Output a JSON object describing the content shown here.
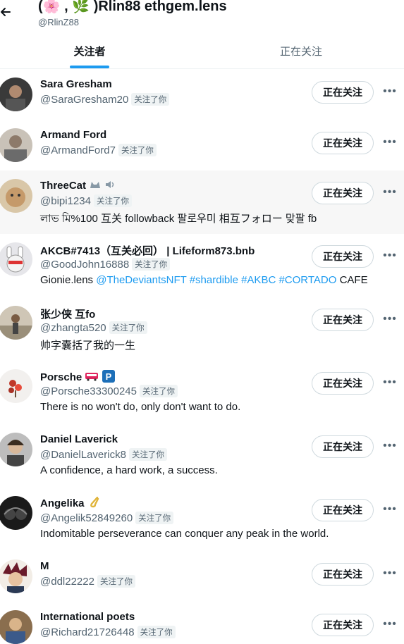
{
  "header": {
    "title": "(🌸 , 🌿 )Rlin88 ethgem.lens",
    "handle": "@RlinZ88"
  },
  "tabs": [
    {
      "label": "关注者"
    },
    {
      "label": "正在关注"
    }
  ],
  "follow_label": "正在关注",
  "follows_you_label": "关注了你",
  "users": [
    {
      "name": "Sara Gresham",
      "handle": "@SaraGresham20",
      "bio": ""
    },
    {
      "name": "Armand Ford",
      "handle": "@ArmandFord7",
      "bio": ""
    },
    {
      "name": "ThreeCat",
      "handle": "@bipi1234",
      "bio": "লাভ মি%100 互关 followback 팔로우미 相互フォロー 맞팔 fb"
    },
    {
      "name": "AKCB#7413（互关必回） | Lifeform873.bnb",
      "handle": "@GoodJohn16888",
      "bio_parts": [
        "Gionie.lens ",
        "@TheDeviantsNFT #shardible #AKBC #CORTADO",
        " CAFE"
      ]
    },
    {
      "name": "张少侠 互fo",
      "handle": "@zhangta520",
      "bio": "帅字囊括了我的一生"
    },
    {
      "name": "Porsche",
      "handle": "@Porsche33300245",
      "bio": "There is no won't do, only don't want to do."
    },
    {
      "name": "Daniel Laverick",
      "handle": "@DanielLaverick8",
      "bio": "A confidence, a hard work, a success."
    },
    {
      "name": "Angelika",
      "handle": "@Angelik52849260",
      "bio": "Indomitable perseverance can conquer any peak in the world."
    },
    {
      "name": "M",
      "handle": "@ddl22222",
      "bio": ""
    },
    {
      "name": "International poets",
      "handle": "@Richard21726448",
      "bio": ""
    }
  ],
  "icons": {
    "back": "arrow-left-icon",
    "more": "more-horizontal-icon",
    "accent": "#1d9bf0"
  }
}
